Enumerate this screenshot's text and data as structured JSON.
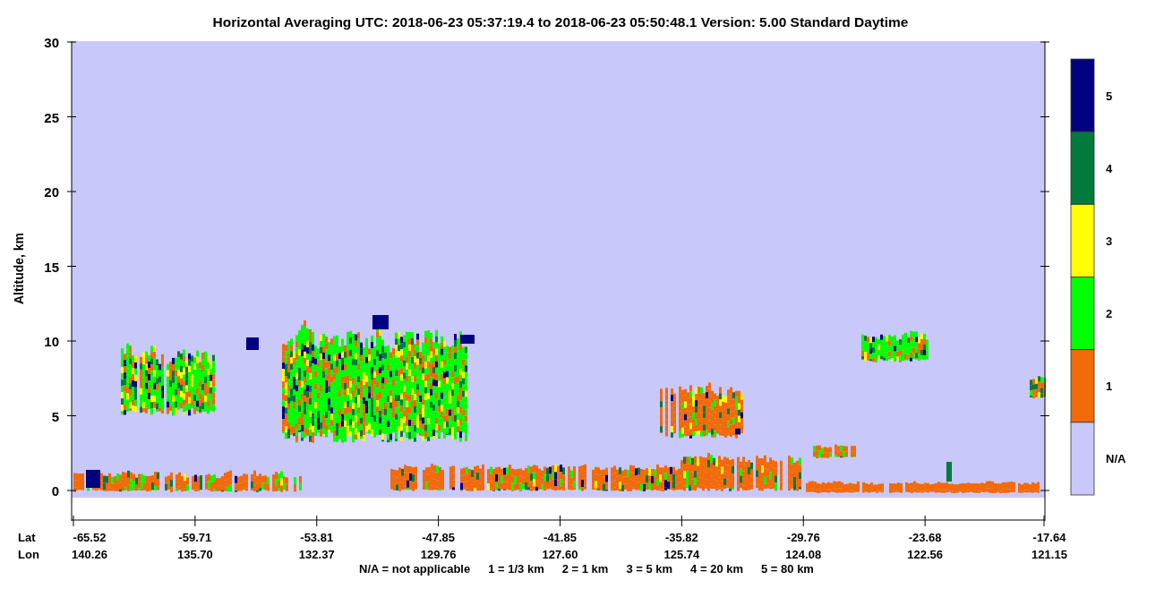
{
  "title": "Horizontal Averaging    UTC:  2018-06-23   05:37:19.4  to  2018-06-23   05:50:48.1    Version: 5.00  Standard Daytime",
  "y_axis": {
    "label": "Altitude, km",
    "ticks": [
      "30",
      "25",
      "20",
      "15",
      "10",
      "5",
      "0"
    ]
  },
  "x_axis": {
    "row_labels": [
      "Lat",
      "Lon"
    ],
    "ticks": [
      {
        "lat": "-65.52",
        "lon": "140.26"
      },
      {
        "lat": "-59.71",
        "lon": "135.70"
      },
      {
        "lat": "-53.81",
        "lon": "132.37"
      },
      {
        "lat": "-47.85",
        "lon": "129.76"
      },
      {
        "lat": "-41.85",
        "lon": "127.60"
      },
      {
        "lat": "-35.82",
        "lon": "125.74"
      },
      {
        "lat": "-29.76",
        "lon": "124.08"
      },
      {
        "lat": "-23.68",
        "lon": "122.56"
      },
      {
        "lat": "-17.64",
        "lon": "121.15"
      }
    ]
  },
  "legend": {
    "items": [
      {
        "label": "5",
        "color": "#000080"
      },
      {
        "label": "4",
        "color": "#007a3d"
      },
      {
        "label": "3",
        "color": "#ffff00"
      },
      {
        "label": "2",
        "color": "#00ff00"
      },
      {
        "label": "1",
        "color": "#f26a0a"
      },
      {
        "label": "N/A",
        "color": "#c8c8fa"
      }
    ]
  },
  "notes": [
    "N/A = not applicable",
    "1 = 1/3 km",
    "2 = 1 km",
    "3 = 5 km",
    "4 = 20 km",
    "5 = 80 km"
  ]
}
